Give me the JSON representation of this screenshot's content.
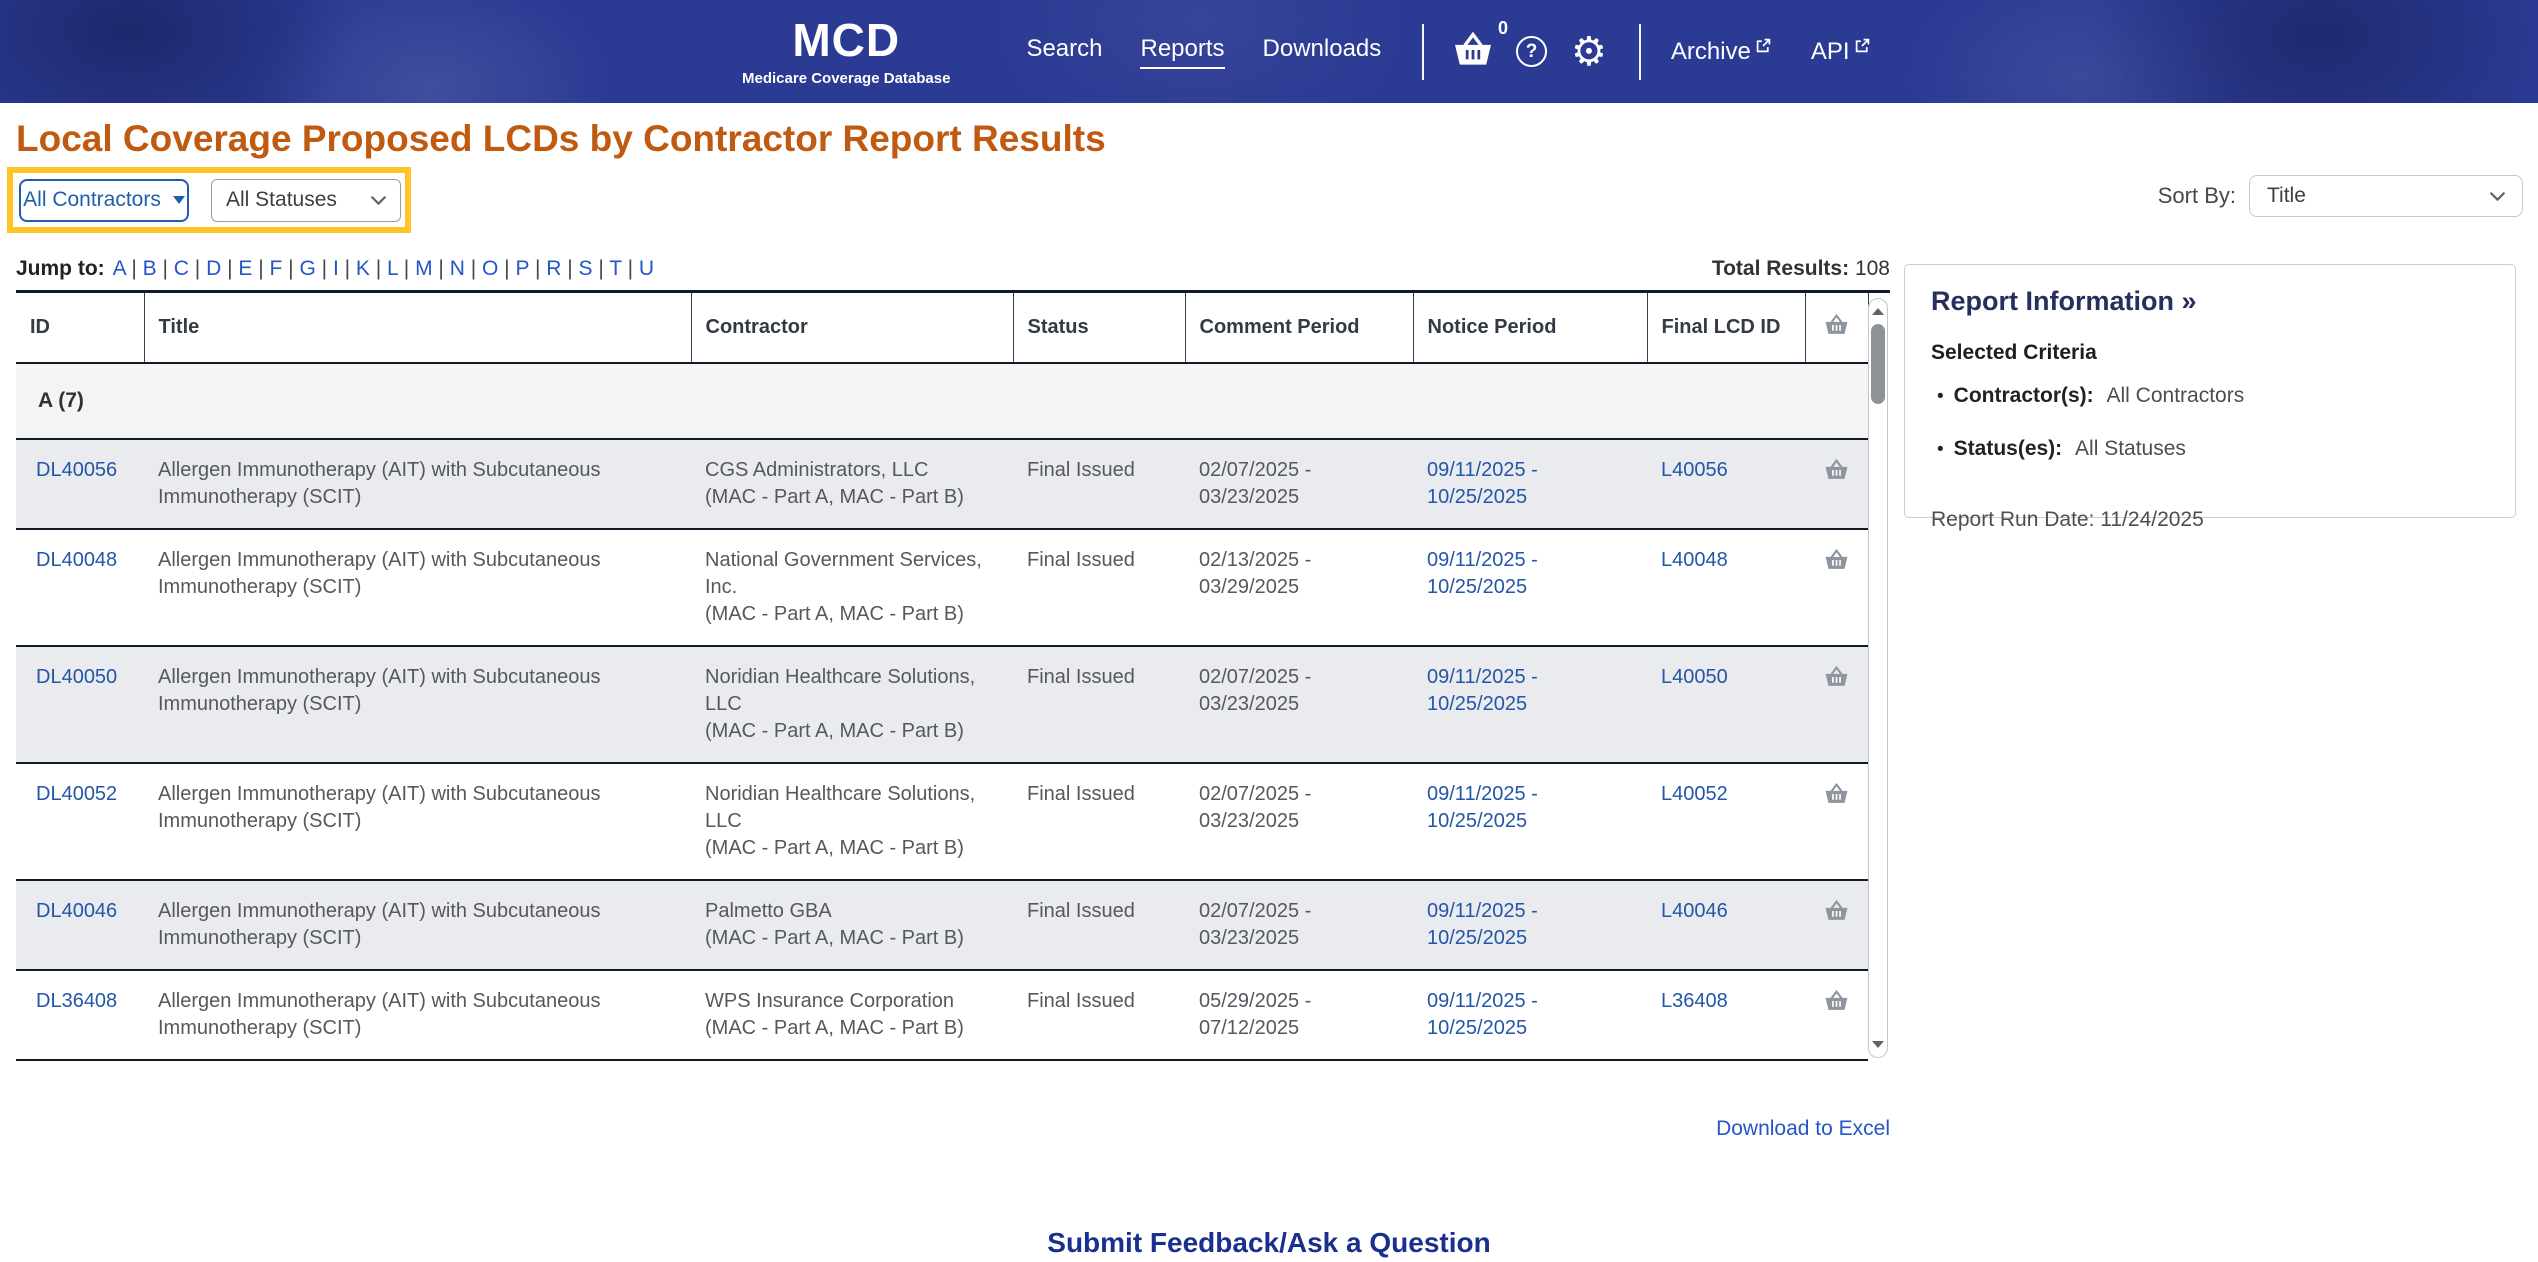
{
  "nav": {
    "logo_title": "MCD",
    "logo_subtitle": "Medicare Coverage Database",
    "links": {
      "search": "Search",
      "reports": "Reports",
      "downloads": "Downloads"
    },
    "cart_count": "0",
    "archive": "Archive",
    "api": "API"
  },
  "page_title": "Local Coverage Proposed LCDs by Contractor Report Results",
  "filters": {
    "contractors": "All Contractors",
    "statuses": "All Statuses",
    "sort_by_label": "Sort By:",
    "sort_by_value": "Title"
  },
  "jump": {
    "label": "Jump to:",
    "letters": [
      "A",
      "B",
      "C",
      "D",
      "E",
      "F",
      "G",
      "I",
      "K",
      "L",
      "M",
      "N",
      "O",
      "P",
      "R",
      "S",
      "T",
      "U"
    ]
  },
  "totals": {
    "label": "Total Results:",
    "value": "108"
  },
  "table": {
    "headers": {
      "id": "ID",
      "title": "Title",
      "contractor": "Contractor",
      "status": "Status",
      "comment": "Comment Period",
      "notice": "Notice Period",
      "final": "Final LCD ID",
      "basket_icon": "basket-icon"
    },
    "section": "A (7)",
    "rows": [
      {
        "id": "DL40056",
        "title": "Allergen Immunotherapy (AIT) with Subcutaneous Immunotherapy (SCIT)",
        "contractor": "CGS Administrators, LLC",
        "contractor_detail": "(MAC - Part A, MAC - Part B)",
        "status": "Final Issued",
        "comment_start": "02/07/2025 -",
        "comment_end": "03/23/2025",
        "notice_start": "09/11/2025 -",
        "notice_end": "10/25/2025",
        "final_lcd_id": "L40056"
      },
      {
        "id": "DL40048",
        "title": "Allergen Immunotherapy (AIT) with Subcutaneous Immunotherapy (SCIT)",
        "contractor": "National Government Services, Inc.",
        "contractor_detail": "(MAC - Part A, MAC - Part B)",
        "status": "Final Issued",
        "comment_start": "02/13/2025 -",
        "comment_end": "03/29/2025",
        "notice_start": "09/11/2025 -",
        "notice_end": "10/25/2025",
        "final_lcd_id": "L40048"
      },
      {
        "id": "DL40050",
        "title": "Allergen Immunotherapy (AIT) with Subcutaneous Immunotherapy (SCIT)",
        "contractor": "Noridian Healthcare Solutions, LLC",
        "contractor_detail": "(MAC - Part A, MAC - Part B)",
        "status": "Final Issued",
        "comment_start": "02/07/2025 -",
        "comment_end": "03/23/2025",
        "notice_start": "09/11/2025 -",
        "notice_end": "10/25/2025",
        "final_lcd_id": "L40050"
      },
      {
        "id": "DL40052",
        "title": "Allergen Immunotherapy (AIT) with Subcutaneous Immunotherapy (SCIT)",
        "contractor": "Noridian Healthcare Solutions, LLC",
        "contractor_detail": "(MAC - Part A, MAC - Part B)",
        "status": "Final Issued",
        "comment_start": "02/07/2025 -",
        "comment_end": "03/23/2025",
        "notice_start": "09/11/2025 -",
        "notice_end": "10/25/2025",
        "final_lcd_id": "L40052"
      },
      {
        "id": "DL40046",
        "title": "Allergen Immunotherapy (AIT) with Subcutaneous Immunotherapy (SCIT)",
        "contractor": "Palmetto GBA",
        "contractor_detail": "(MAC - Part A, MAC - Part B)",
        "status": "Final Issued",
        "comment_start": "02/07/2025 -",
        "comment_end": "03/23/2025",
        "notice_start": "09/11/2025 -",
        "notice_end": "10/25/2025",
        "final_lcd_id": "L40046"
      },
      {
        "id": "DL36408",
        "title": "Allergen Immunotherapy (AIT) with Subcutaneous Immunotherapy (SCIT)",
        "contractor": "WPS Insurance Corporation",
        "contractor_detail": "(MAC - Part A, MAC - Part B)",
        "status": "Final Issued",
        "comment_start": "05/29/2025 -",
        "comment_end": "07/12/2025",
        "notice_start": "09/11/2025 -",
        "notice_end": "10/25/2025",
        "final_lcd_id": "L36408"
      }
    ]
  },
  "report_info": {
    "heading": "Report Information »",
    "criteria_heading": "Selected Criteria",
    "contractor_label": "Contractor(s):",
    "contractor_value": "All Contractors",
    "status_label": "Status(es):",
    "status_value": "All Statuses",
    "run_date": "Report Run Date: 11/24/2025"
  },
  "actions": {
    "download": "Download to Excel",
    "feedback": "Submit Feedback/Ask a Question"
  },
  "colors": {
    "header_bg": "#2b3a93",
    "title_orange": "#c05a10",
    "highlight_yellow": "#ffc425",
    "link_blue": "#2456a8",
    "footer_navy": "#1b2f8e",
    "alt_row": "#e9ebee"
  }
}
